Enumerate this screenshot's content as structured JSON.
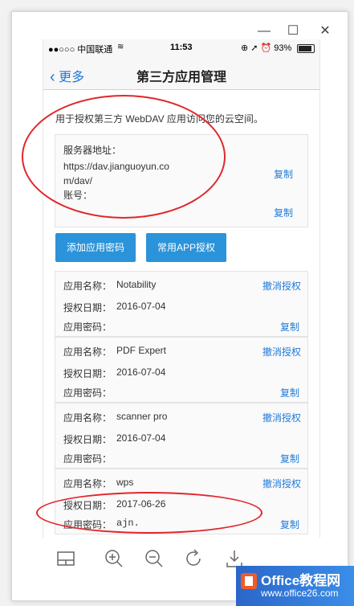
{
  "window": {
    "min_icon": "minimize-icon",
    "max_icon": "maximize-icon",
    "close_icon": "close-icon"
  },
  "status_bar": {
    "carrier": "●●○○○ 中国联通",
    "wifi": "wifi-icon",
    "time": "11:53",
    "right": "⊕ ➚ ⏰ 93%",
    "battery_icon": "battery-icon"
  },
  "nav": {
    "back": "更多",
    "title": "第三方应用管理"
  },
  "intro": "用于授权第三方 WebDAV 应用访问您的云空间。",
  "server": {
    "label": "服务器地址：",
    "url_line1": "https://dav.jianguoyun.co",
    "url_line2": "m/dav/",
    "account_label": "账号：",
    "copy1": "复制",
    "copy2": "复制"
  },
  "buttons": {
    "add": "添加应用密码",
    "common": "常用APP授权"
  },
  "labels": {
    "name": "应用名称：",
    "date": "授权日期：",
    "pwd": "应用密码：",
    "revoke": "撤消授权",
    "copy": "复制"
  },
  "apps": [
    {
      "name": "Notability",
      "date": "2016-07-04",
      "pwd": ""
    },
    {
      "name": "PDF Expert",
      "date": "2016-07-04",
      "pwd": ""
    },
    {
      "name": "scanner pro",
      "date": "2016-07-04",
      "pwd": ""
    },
    {
      "name": "wps",
      "date": "2017-06-26",
      "pwd": "ajn."
    }
  ],
  "toolbar": [
    "layout-icon",
    "zoom-in-icon",
    "zoom-out-icon",
    "rotate-icon",
    "download-icon"
  ],
  "watermark": {
    "main": "Office教程网",
    "url": "www.office26.com"
  },
  "colors": {
    "accent": "#1f7ad9",
    "button": "#2b93d9",
    "annotation": "#e2262b"
  }
}
